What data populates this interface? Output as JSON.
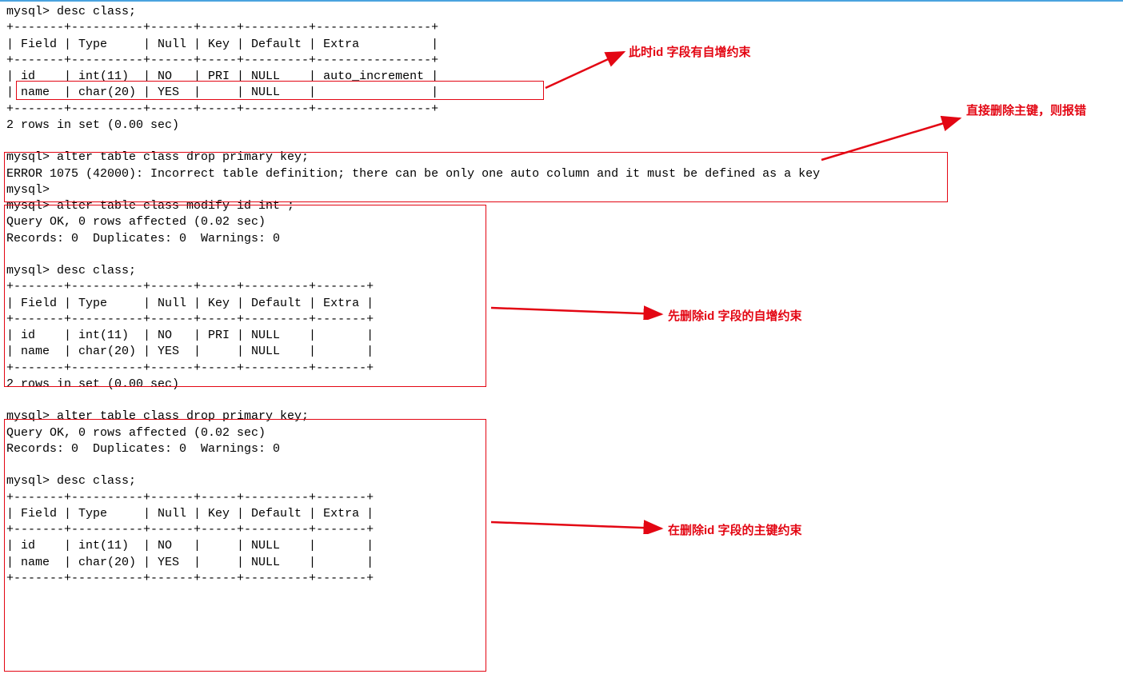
{
  "section1": {
    "cmd1": "mysql> desc class;",
    "sep_long": "+-------+----------+------+-----+---------+----------------+",
    "header_long": "| Field | Type     | Null | Key | Default | Extra          |",
    "row_id": "| id    | int(11)  | NO   | PRI | NULL    | auto_increment |",
    "row_name": "| name  | char(20) | YES  |     | NULL    |                |",
    "result": "2 rows in set (0.00 sec)"
  },
  "section2": {
    "cmd": "mysql> alter table class drop primary key;",
    "error": "ERROR 1075 (42000): Incorrect table definition; there can be only one auto column and it must be defined as a key",
    "prompt": "mysql>"
  },
  "section3": {
    "cmd_modify": "mysql> alter table class modify id int ;",
    "query_ok": "Query OK, 0 rows affected (0.02 sec)",
    "records": "Records: 0  Duplicates: 0  Warnings: 0",
    "cmd_desc": "mysql> desc class;",
    "sep": "+-------+----------+------+-----+---------+-------+",
    "header": "| Field | Type     | Null | Key | Default | Extra |",
    "row_id": "| id    | int(11)  | NO   | PRI | NULL    |       |",
    "row_name": "| name  | char(20) | YES  |     | NULL    |       |",
    "result": "2 rows in set (0.00 sec)"
  },
  "section4": {
    "cmd_drop": "mysql> alter table class drop primary key;",
    "query_ok": "Query OK, 0 rows affected (0.02 sec)",
    "records": "Records: 0  Duplicates: 0  Warnings: 0",
    "cmd_desc": "mysql> desc class;",
    "sep": "+-------+----------+------+-----+---------+-------+",
    "header": "| Field | Type     | Null | Key | Default | Extra |",
    "row_id": "| id    | int(11)  | NO   |     | NULL    |       |",
    "row_name": "| name  | char(20) | YES  |     | NULL    |       |"
  },
  "annotations": {
    "a1": "此时id 字段有自增约束",
    "a2": "直接删除主键，则报错",
    "a3": "先删除id 字段的自增约束",
    "a4": "在删除id 字段的主键约束"
  }
}
